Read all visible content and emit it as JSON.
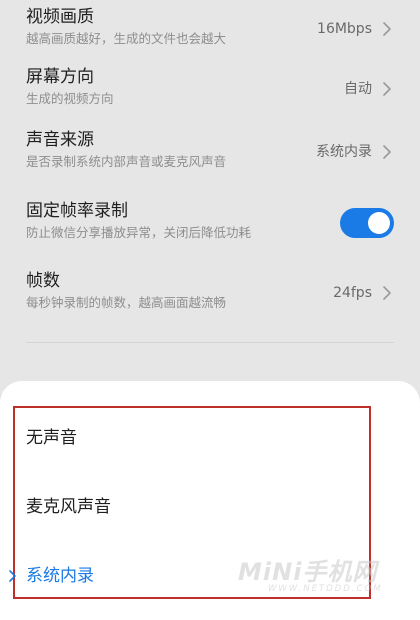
{
  "settings": {
    "items": [
      {
        "title": "视频画质",
        "subtitle": "越高画质越好，生成的文件也会越大",
        "value": "16Mbps"
      },
      {
        "title": "屏幕方向",
        "subtitle": "生成的视频方向",
        "value": "自动"
      },
      {
        "title": "声音来源",
        "subtitle": "是否录制系统内部声音或麦克风声音",
        "value": "系统内录"
      },
      {
        "title": "固定帧率录制",
        "subtitle": "防止微信分享播放异常，关闭后降低功耗",
        "toggle_on": true
      },
      {
        "title": "帧数",
        "subtitle": "每秒钟录制的帧数，越高画面越流畅",
        "value": "24fps"
      }
    ]
  },
  "sheet": {
    "options": [
      {
        "label": "无声音",
        "selected": false
      },
      {
        "label": "麦克风声音",
        "selected": false
      },
      {
        "label": "系统内录",
        "selected": true
      }
    ]
  },
  "watermark": {
    "main": "MiNi手机网",
    "sub": "WWW.NETDDD.COM"
  },
  "colors": {
    "background": "#e6e6e6",
    "accent": "#1a7ae6",
    "highlight_border": "#c0302a",
    "sheet": "#ffffff"
  }
}
